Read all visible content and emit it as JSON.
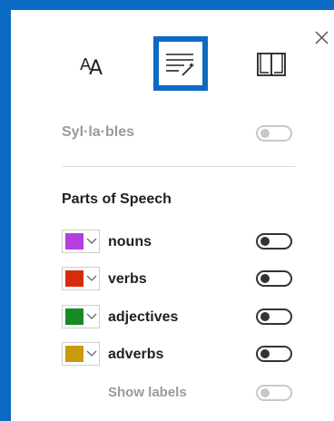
{
  "tabs": [
    {
      "name": "text-preferences",
      "icon": "text-size-icon"
    },
    {
      "name": "grammar-options",
      "icon": "grammar-magic-icon",
      "selected": true
    },
    {
      "name": "reading-preferences",
      "icon": "book-icon"
    }
  ],
  "syllables": {
    "label": "Syl·la·bles",
    "enabled": false,
    "disabled": true
  },
  "parts_of_speech": {
    "title": "Parts of Speech",
    "items": [
      {
        "label": "nouns",
        "color": "#b43fdf",
        "enabled": false
      },
      {
        "label": "verbs",
        "color": "#d92b0c",
        "enabled": false
      },
      {
        "label": "adjectives",
        "color": "#178a24",
        "enabled": false
      },
      {
        "label": "adverbs",
        "color": "#c99b0b",
        "enabled": false
      }
    ],
    "show_labels": {
      "label": "Show labels",
      "enabled": false,
      "disabled": true
    }
  },
  "colors": {
    "accent": "#0b6ac1",
    "text": "#1f1f1f",
    "muted": "#9a9a9a"
  }
}
